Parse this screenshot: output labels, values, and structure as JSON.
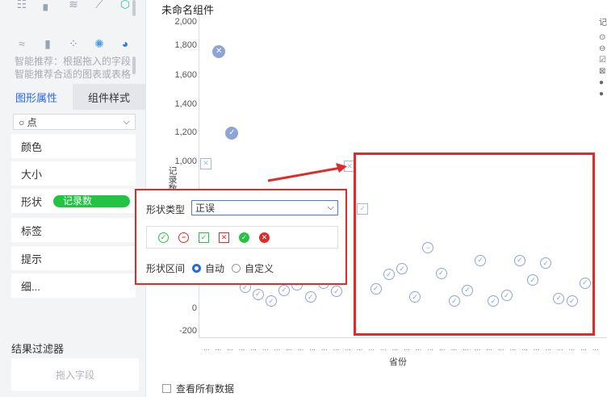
{
  "left_panel": {
    "icon_rows": [
      [
        "grid-table-icon",
        "scatter-bar-icon",
        "wave-chart-icon",
        "line-chart-icon",
        "gear-cube-icon"
      ],
      [
        "area-chart-icon",
        "bar-chart-icon",
        "scatter-icon",
        "bubble-icon",
        "pie-chart-icon"
      ]
    ],
    "hint_line1": "智能推荐：根据拖入的字段",
    "hint_line2": "智能推荐合适的图表或表格",
    "tabs": [
      {
        "label": "图形属性",
        "active": true
      },
      {
        "label": "组件样式",
        "active": false
      }
    ],
    "mark_type": "○ 点",
    "props": [
      "颜色",
      "大小",
      "形状",
      "标签",
      "提示",
      "细..."
    ],
    "shape_field": "记录数",
    "filter_title": "结果过滤器",
    "filter_drop": "拖入字段"
  },
  "chart": {
    "component_title": "未命名组件",
    "y_axis_title": "记录数",
    "x_axis_title": "省份",
    "y_ticks": [
      "2,000",
      "1,800",
      "1,600",
      "1,400",
      "1,200",
      "1,000",
      "0",
      "-200"
    ],
    "x_tick_placeholder": "...",
    "view_all_label": "查看所有数据",
    "legend_initial": "记"
  },
  "shape_popup": {
    "type_label": "形状类型",
    "type_value": "正误",
    "range_label": "形状区间",
    "option_auto": "自动",
    "option_custom": "自定义",
    "selected": "自动"
  },
  "chart_data": {
    "type": "scatter",
    "ylabel": "记录数",
    "xlabel": "省份",
    "ylim": [
      -200,
      2000
    ],
    "points": [
      {
        "shape": "square-cross",
        "y": 990
      },
      {
        "shape": "filled-cross",
        "y": 1790
      },
      {
        "shape": "filled-check",
        "y": 1210
      },
      {
        "shape": "circle-check",
        "y": 110
      },
      {
        "shape": "circle-check",
        "y": 60
      },
      {
        "shape": "circle-check",
        "y": 10
      },
      {
        "shape": "circle-check",
        "y": 90
      },
      {
        "shape": "circle-check",
        "y": 130
      },
      {
        "shape": "circle-check",
        "y": 40
      },
      {
        "shape": "circle-check",
        "y": 140
      },
      {
        "shape": "circle-check",
        "y": 80
      },
      {
        "shape": "square-cross",
        "y": 970
      },
      {
        "shape": "square-check",
        "y": 670
      },
      {
        "shape": "circle-check",
        "y": 100
      },
      {
        "shape": "circle-check",
        "y": 200
      },
      {
        "shape": "circle-check",
        "y": 240
      },
      {
        "shape": "circle-check",
        "y": 40
      },
      {
        "shape": "circle-minus",
        "y": 390
      },
      {
        "shape": "circle-check",
        "y": 210
      },
      {
        "shape": "circle-check",
        "y": 10
      },
      {
        "shape": "circle-check",
        "y": 90
      },
      {
        "shape": "circle-check",
        "y": 300
      },
      {
        "shape": "circle-check",
        "y": 10
      },
      {
        "shape": "circle-check",
        "y": 50
      },
      {
        "shape": "circle-check",
        "y": 300
      },
      {
        "shape": "circle-check",
        "y": 160
      },
      {
        "shape": "circle-check",
        "y": 280
      },
      {
        "shape": "circle-check",
        "y": 30
      },
      {
        "shape": "circle-check",
        "y": 10
      },
      {
        "shape": "circle-check",
        "y": 140
      }
    ]
  }
}
